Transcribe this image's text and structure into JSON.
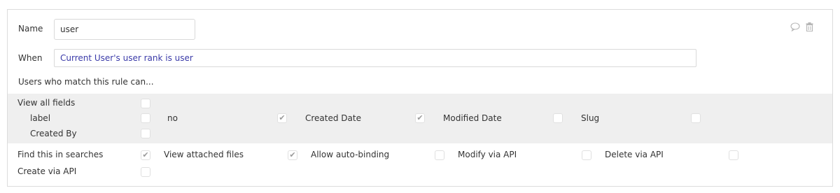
{
  "rule": {
    "name_label": "Name",
    "name_value": "user",
    "when_label": "When",
    "when_value": "Current User's user rank is user",
    "users_match_text": "Users who match this rule can...",
    "accent_color": "#3a3aa8"
  },
  "view_fields": {
    "view_all_label": "View all fields",
    "view_all_checked": false,
    "fields": [
      {
        "label": "label",
        "checked": false
      },
      {
        "label": "no",
        "checked": true
      },
      {
        "label": "Created Date",
        "checked": true
      },
      {
        "label": "Modified Date",
        "checked": false
      },
      {
        "label": "Slug",
        "checked": false
      },
      {
        "label": "Created By",
        "checked": false
      }
    ]
  },
  "permissions": [
    {
      "label": "Find this in searches",
      "checked": true
    },
    {
      "label": "View attached files",
      "checked": true
    },
    {
      "label": "Allow auto-binding",
      "checked": false
    },
    {
      "label": "Modify via API",
      "checked": false
    },
    {
      "label": "Delete via API",
      "checked": false
    },
    {
      "label": "Create via API",
      "checked": false
    }
  ],
  "icons": {
    "comment": "comment-icon",
    "delete": "trash-icon"
  }
}
